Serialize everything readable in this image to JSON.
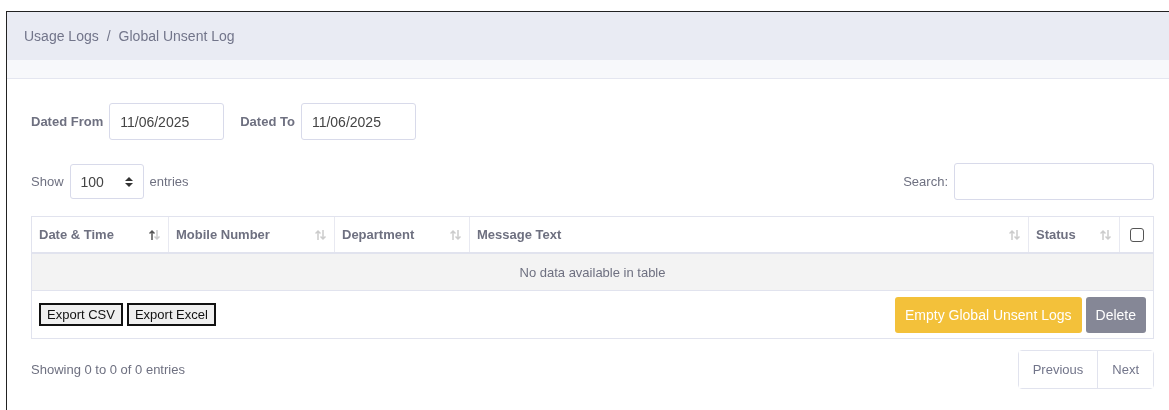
{
  "breadcrumb": [
    "Usage Logs",
    "Global Unsent Log"
  ],
  "breadcrumb_separator": "/",
  "filters": [
    {
      "label": "Dated From",
      "value": "11/06/2025"
    },
    {
      "label": "Dated To",
      "value": "11/06/2025"
    }
  ],
  "length": {
    "before": "Show",
    "value": "100",
    "after": "entries"
  },
  "search": {
    "label": "Search:"
  },
  "table": {
    "columns": [
      {
        "label": "Date & Time",
        "sorted": true
      },
      {
        "label": "Mobile Number",
        "sorted": false
      },
      {
        "label": "Department",
        "sorted": false
      },
      {
        "label": "Message Text",
        "sorted": false
      },
      {
        "label": "Status",
        "sorted": false
      }
    ],
    "select_all": {
      "checked": false
    },
    "empty_message": "No data available in table"
  },
  "export_buttons": [
    "Export CSV",
    "Export Excel"
  ],
  "action_buttons": [
    {
      "label": "Empty Global Unsent Logs",
      "kind": "warning"
    },
    {
      "label": "Delete",
      "kind": "secondary"
    }
  ],
  "info": "Showing 0 to 0 of 0 entries",
  "pagination": [
    "Previous",
    "Next"
  ]
}
